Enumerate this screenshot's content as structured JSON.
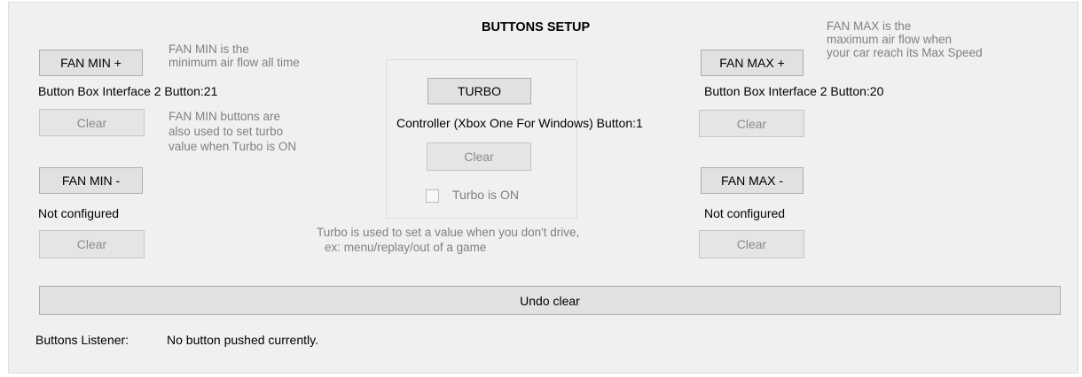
{
  "title": "BUTTONS SETUP",
  "fan_min_plus": {
    "button_label": "FAN MIN +",
    "description": [
      "FAN MIN is the",
      "minimum air flow all time"
    ],
    "binding": "Button Box Interface 2 Button:21",
    "clear_label": "Clear",
    "turbo_note": [
      "FAN MIN buttons are",
      "also used to set turbo",
      "value when Turbo is ON"
    ]
  },
  "fan_min_minus": {
    "button_label": "FAN MIN -",
    "binding": "Not configured",
    "clear_label": "Clear"
  },
  "turbo": {
    "button_label": "TURBO",
    "binding": "Controller (Xbox One For Windows) Button:1",
    "clear_label": "Clear",
    "checkbox_label": "Turbo is ON",
    "checkbox_checked": false,
    "note": [
      "Turbo is used to set a value when you don't drive,",
      "ex: menu/replay/out of a game"
    ]
  },
  "fan_max_plus": {
    "button_label": "FAN MAX +",
    "description": [
      "FAN MAX is the",
      "maximum air flow when",
      "your car reach its Max Speed"
    ],
    "binding": "Button Box Interface 2 Button:20",
    "clear_label": "Clear"
  },
  "fan_max_minus": {
    "button_label": "FAN MAX -",
    "binding": "Not configured",
    "clear_label": "Clear"
  },
  "undo_label": "Undo clear",
  "listener": {
    "label": "Buttons Listener:",
    "status": "No button pushed currently."
  }
}
